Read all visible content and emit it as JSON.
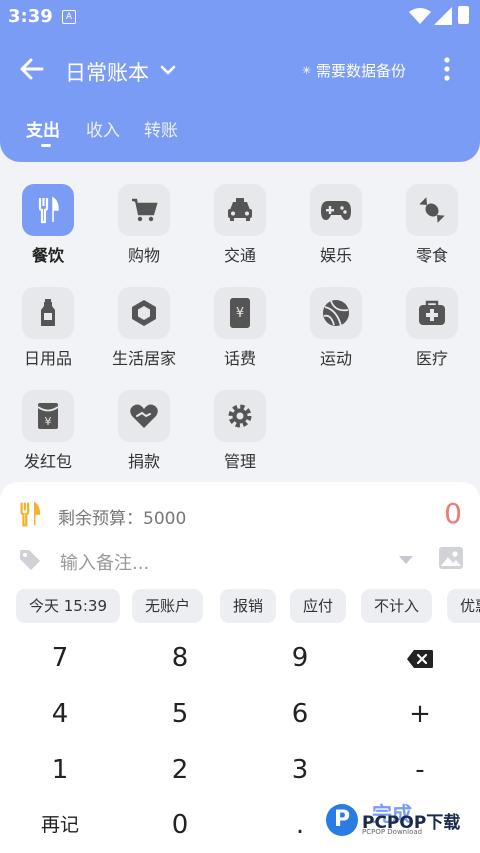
{
  "status_bar": {
    "time": "3:39",
    "notification_badge": "A"
  },
  "header": {
    "title": "日常账本",
    "backup_text": "需要数据备份",
    "tabs": [
      {
        "label": "支出",
        "active": true
      },
      {
        "label": "收入",
        "active": false
      },
      {
        "label": "转账",
        "active": false
      }
    ]
  },
  "categories": [
    {
      "label": "餐饮",
      "icon": "utensils-icon",
      "active": true
    },
    {
      "label": "购物",
      "icon": "cart-icon",
      "active": false
    },
    {
      "label": "交通",
      "icon": "taxi-icon",
      "active": false
    },
    {
      "label": "娱乐",
      "icon": "gamepad-icon",
      "active": false
    },
    {
      "label": "零食",
      "icon": "candy-icon",
      "active": false
    },
    {
      "label": "日用品",
      "icon": "bottle-icon",
      "active": false
    },
    {
      "label": "生活居家",
      "icon": "home-box-icon",
      "active": false
    },
    {
      "label": "话费",
      "icon": "phone-yen-icon",
      "active": false
    },
    {
      "label": "运动",
      "icon": "ball-icon",
      "active": false
    },
    {
      "label": "医疗",
      "icon": "medkit-icon",
      "active": false
    },
    {
      "label": "发红包",
      "icon": "red-packet-icon",
      "active": false
    },
    {
      "label": "捐款",
      "icon": "heart-hand-icon",
      "active": false
    },
    {
      "label": "管理",
      "icon": "gear-icon",
      "active": false
    }
  ],
  "entry": {
    "budget_text": "剩余预算：5000",
    "amount": "0",
    "note_placeholder": "输入备注..."
  },
  "chips": [
    "今天 15:39",
    "无账户",
    "报销",
    "应付",
    "不计入",
    "优惠"
  ],
  "keypad": {
    "rows": [
      [
        "7",
        "8",
        "9",
        "⌫"
      ],
      [
        "4",
        "5",
        "6",
        "+"
      ],
      [
        "1",
        "2",
        "3",
        "-"
      ],
      [
        "再记",
        "0",
        ".",
        "完成"
      ]
    ]
  },
  "watermark": {
    "brand": "PCPOP下载",
    "sub": "PCPOP Download"
  },
  "colors": {
    "accent": "#7b9cf5",
    "amount": "#ec7b7b",
    "chip_bg": "#eceef2",
    "icon_bg": "#e7e8ec"
  }
}
